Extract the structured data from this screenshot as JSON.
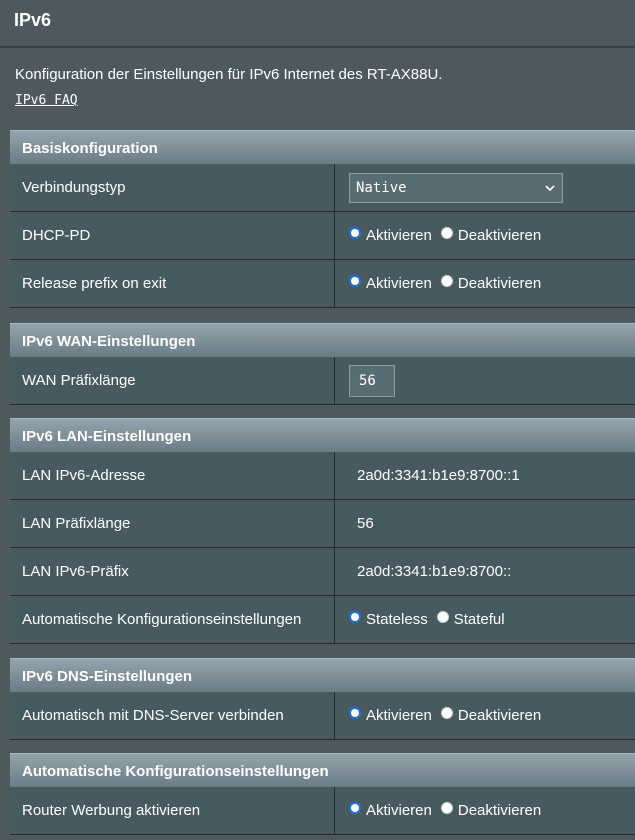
{
  "header": {
    "title": "IPv6",
    "description": "Konfiguration der Einstellungen für IPv6 Internet des RT-AX88U.",
    "faq_link": "IPv6 FAQ"
  },
  "basis": {
    "title": "Basiskonfiguration",
    "connection_type_label": "Verbindungstyp",
    "connection_type_value": "Native",
    "dhcp_pd_label": "DHCP-PD",
    "dhcp_pd_options": [
      "Aktivieren",
      "Deaktivieren"
    ],
    "dhcp_pd_selected": "Aktivieren",
    "release_prefix_label": "Release prefix on exit",
    "release_prefix_options": [
      "Aktivieren",
      "Deaktivieren"
    ],
    "release_prefix_selected": "Aktivieren"
  },
  "wan": {
    "title": "IPv6 WAN-Einstellungen",
    "prefix_length_label": "WAN Präfixlänge",
    "prefix_length_value": "56"
  },
  "lan": {
    "title": "IPv6 LAN-Einstellungen",
    "address_label": "LAN IPv6-Adresse",
    "address_value": "2a0d:3341:b1e9:8700::1",
    "prefix_length_label": "LAN Präfixlänge",
    "prefix_length_value": "56",
    "prefix_label": "LAN IPv6-Präfix",
    "prefix_value": "2a0d:3341:b1e9:8700::",
    "autoconf_label": "Automatische Konfigurationseinstellungen",
    "autoconf_options": [
      "Stateless",
      "Stateful"
    ],
    "autoconf_selected": "Stateless"
  },
  "dns": {
    "title": "IPv6 DNS-Einstellungen",
    "auto_dns_label": "Automatisch mit DNS-Server verbinden",
    "auto_dns_options": [
      "Aktivieren",
      "Deaktivieren"
    ],
    "auto_dns_selected": "Aktivieren"
  },
  "autoconf": {
    "title": "Automatische Konfigurationseinstellungen",
    "router_adv_label": "Router Werbung aktivieren",
    "router_adv_options": [
      "Aktivieren",
      "Deaktivieren"
    ],
    "router_adv_selected": "Aktivieren"
  },
  "colors": {
    "background": "#4d595d",
    "header_gradient_top": "#93a4ad",
    "header_gradient_bottom": "#6a7c85",
    "row_background": "#475a5f",
    "radio_selected": "#1e74d6"
  },
  "icons": {
    "select_arrow": "chevron-down-icon"
  }
}
